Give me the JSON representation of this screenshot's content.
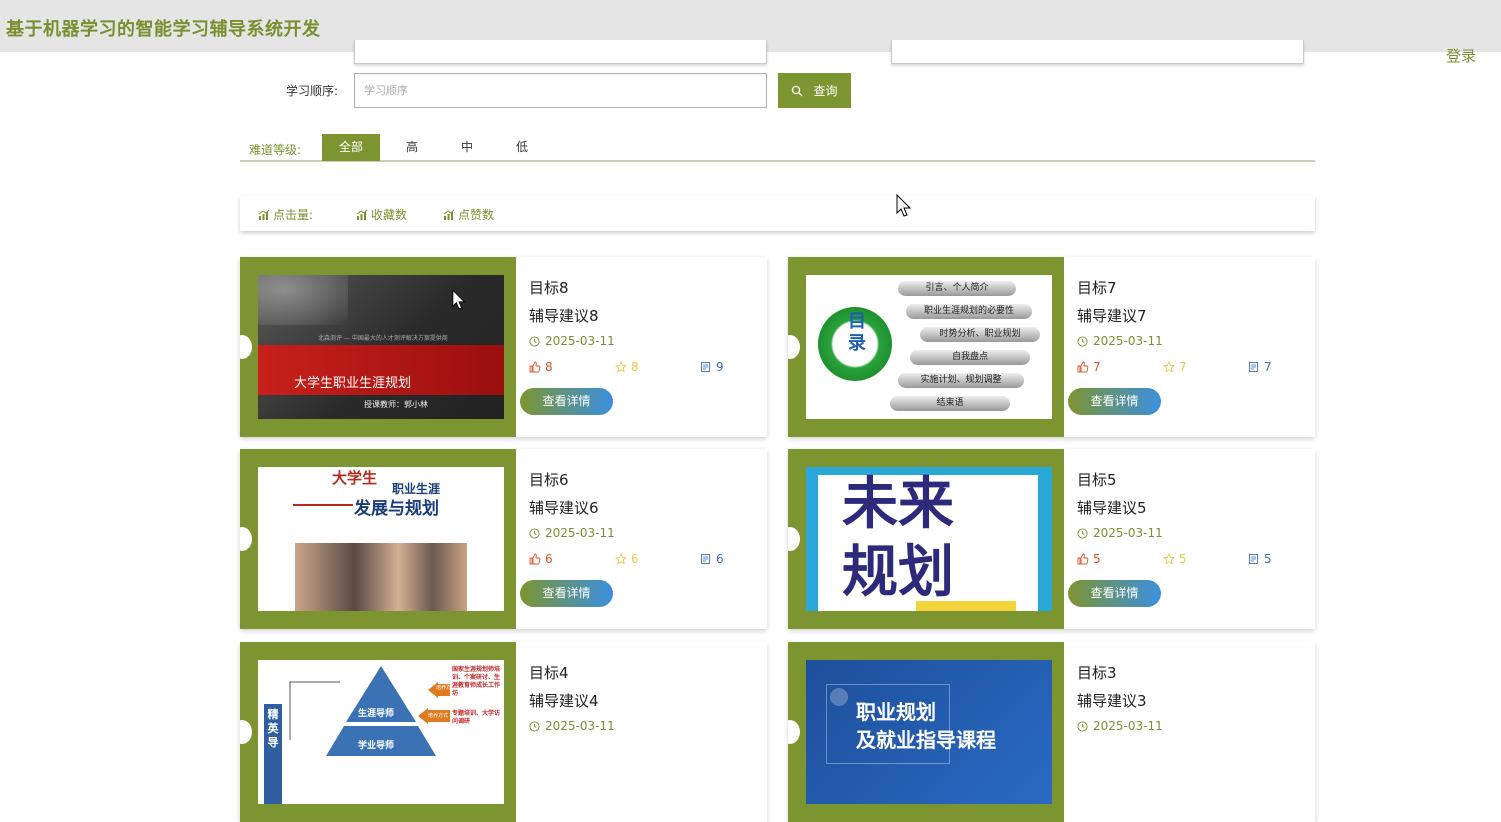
{
  "header": {
    "title": "基于机器学习的智能学习辅导系统开发",
    "login": "登录"
  },
  "search": {
    "label": "学习顺序:",
    "placeholder": "学习顺序",
    "button": "查询"
  },
  "filter": {
    "label": "难道等级:",
    "options": [
      "全部",
      "高",
      "中",
      "低"
    ],
    "selected": "全部"
  },
  "sort": {
    "items": [
      "点击量:",
      "收藏数",
      "点赞数"
    ]
  },
  "cards": [
    {
      "title": "目标8",
      "subtitle": "辅导建议8",
      "date": "2025-03-11",
      "likes": "8",
      "favorites": "8",
      "views": "9",
      "button": "查看详情",
      "image": {
        "line1": "北森测评 — 中国最大的人才测评解决方案提供商",
        "title": "大学生职业生涯规划",
        "teacher": "授课教师：郭小林"
      }
    },
    {
      "title": "目标7",
      "subtitle": "辅导建议7",
      "date": "2025-03-11",
      "likes": "7",
      "favorites": "7",
      "views": "7",
      "button": "查看详情",
      "image": {
        "center": "目录",
        "items": [
          "引言、个人简介",
          "职业生涯规划的必要性",
          "时势分析、职业规划",
          "自我盘点",
          "实施计划、规划调整",
          "结束语"
        ]
      }
    },
    {
      "title": "目标6",
      "subtitle": "辅导建议6",
      "date": "2025-03-11",
      "likes": "6",
      "favorites": "6",
      "views": "6",
      "button": "查看详情",
      "image": {
        "top": "大学生",
        "line1": "职业生涯",
        "line2": "发展与规划"
      }
    },
    {
      "title": "目标5",
      "subtitle": "辅导建议5",
      "date": "2025-03-11",
      "likes": "5",
      "favorites": "5",
      "views": "5",
      "button": "查看详情",
      "image": {
        "line1": "未来",
        "line2": "规划"
      }
    },
    {
      "title": "目标4",
      "subtitle": "辅导建议4",
      "date": "2025-03-11",
      "likes": "",
      "favorites": "",
      "views": "",
      "button": "查看详情",
      "image": {
        "side": "精英导",
        "tier1": "生涯导师",
        "tier2": "学业导师",
        "tag1": "国家生涯规划师培训、个案研讨、生涯教育师成长工作坊",
        "tag2": "专题培训、大学访问调研",
        "arrow1": "培养方式",
        "arrow2": "培养方式"
      }
    },
    {
      "title": "目标3",
      "subtitle": "辅导建议3",
      "date": "2025-03-11",
      "likes": "",
      "favorites": "",
      "views": "",
      "button": "查看详情",
      "image": {
        "line1": "职业规划",
        "line2": "及就业指导课程"
      }
    }
  ],
  "colors": {
    "accent": "#7c9530",
    "like": "#d9532b",
    "favorite": "#e7c94a",
    "view": "#3f6fb0",
    "topbar": "#e5e5e5"
  }
}
